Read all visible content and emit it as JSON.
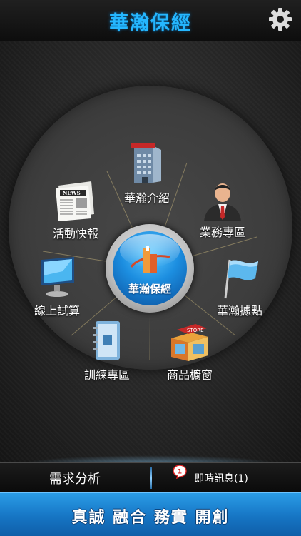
{
  "header": {
    "title": "華瀚保經",
    "settings_icon": "gear-icon"
  },
  "menu": {
    "center_label": "華瀚保經",
    "items": [
      {
        "key": "company",
        "label": "華瀚介紹",
        "icon": "company-building-icon"
      },
      {
        "key": "business",
        "label": "業務專區",
        "icon": "businessman-icon"
      },
      {
        "key": "locations",
        "label": "華瀚據點",
        "icon": "flag-icon"
      },
      {
        "key": "store",
        "label": "商品櫥窗",
        "icon": "store-icon"
      },
      {
        "key": "training",
        "label": "訓練專區",
        "icon": "binder-icon"
      },
      {
        "key": "calculator",
        "label": "線上試算",
        "icon": "monitor-icon"
      },
      {
        "key": "news",
        "label": "活動快報",
        "icon": "newspaper-icon"
      }
    ]
  },
  "bottom": {
    "needs_label": "需求分析",
    "message_label": "即時訊息(1)",
    "message_badge": "1"
  },
  "footer": {
    "slogan": "真誠 融合 務實 開創"
  },
  "colors": {
    "title": "#25b7ff",
    "footer": "#1675c4",
    "accent": "#1c8ee0"
  }
}
